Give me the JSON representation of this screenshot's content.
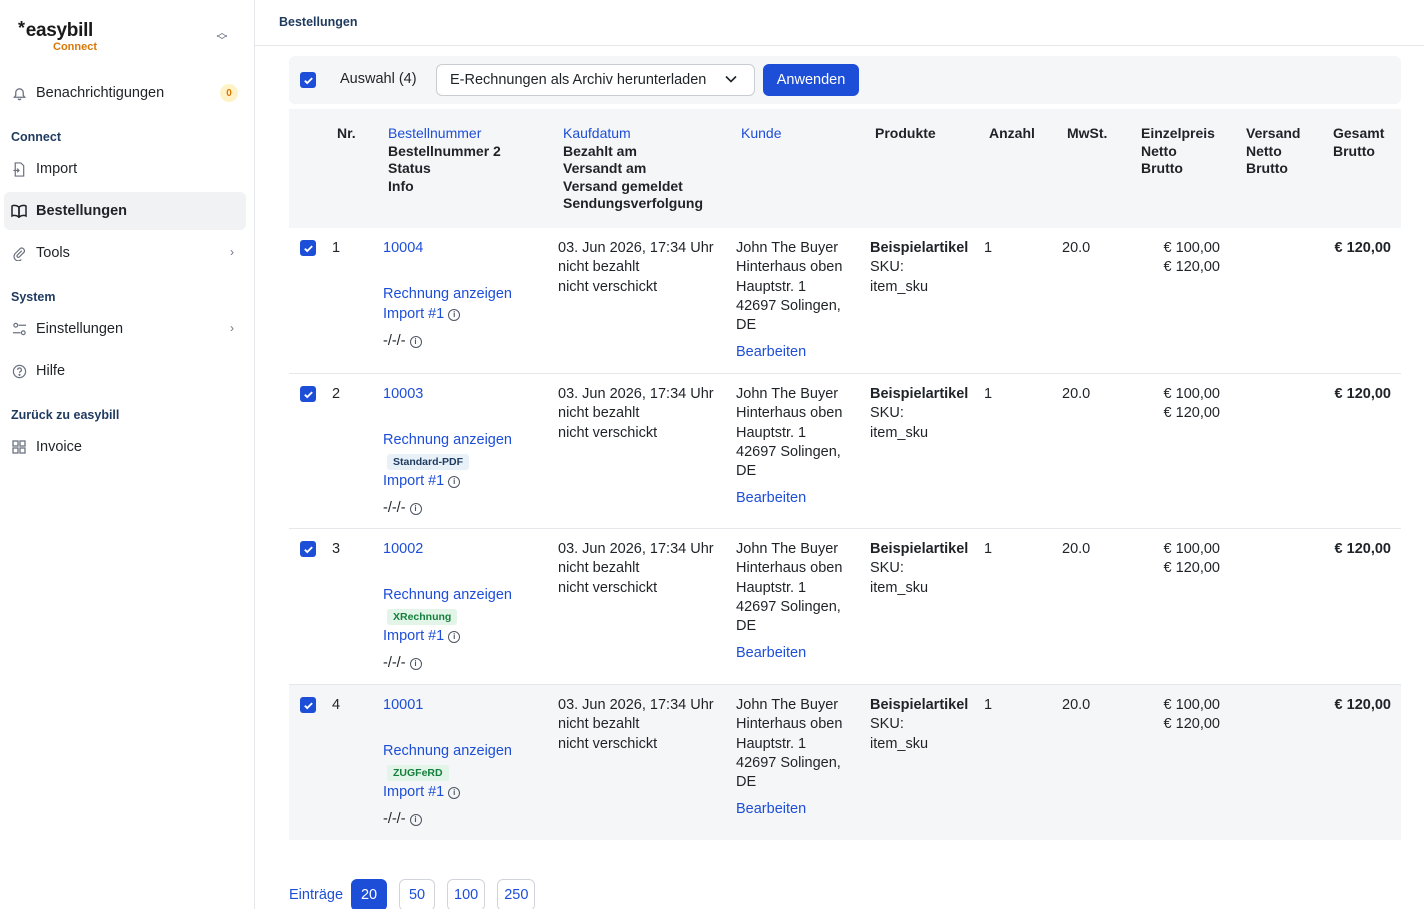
{
  "sidebar": {
    "logo_brand": "easybill",
    "logo_sub": "Connect",
    "notifications": {
      "label": "Benachrichtigungen",
      "count": "0"
    },
    "sections": {
      "connect": "Connect",
      "system": "System",
      "back": "Zurück zu easybill"
    },
    "items": {
      "import": "Import",
      "orders": "Bestellungen",
      "tools": "Tools",
      "settings": "Einstellungen",
      "help": "Hilfe",
      "invoice": "Invoice"
    }
  },
  "header": {
    "breadcrumb": "Bestellungen"
  },
  "bulk": {
    "selection": "Auswahl (4)",
    "action": "E-Rechnungen als Archiv herunterladen",
    "apply": "Anwenden"
  },
  "columns": {
    "nr": "Nr.",
    "order_link": "Bestellnummer",
    "order_lines": [
      "Bestellnummer 2",
      "Status",
      "Info"
    ],
    "date_link": "Kaufdatum",
    "date_lines": [
      "Bezahlt am",
      "Versandt am",
      "Versand gemeldet",
      "Sendungsverfolgung"
    ],
    "customer_link": "Kunde",
    "products": "Produkte",
    "qty": "Anzahl",
    "vat": "MwSt.",
    "unit_price_lines": [
      "Einzelpreis",
      "Netto",
      "Brutto"
    ],
    "shipping_lines": [
      "Versand",
      "Netto",
      "Brutto"
    ],
    "total_lines": [
      "Gesamt",
      "Brutto"
    ]
  },
  "rows": [
    {
      "nr": "1",
      "order": "10004",
      "invoice_link": "Rechnung anzeigen",
      "tag": "",
      "import": "Import #1",
      "info": "-/-/-",
      "date": "03. Jun 2026, 17:34 Uhr",
      "paid": "nicht bezahlt",
      "shipped": "nicht verschickt",
      "customer": [
        "John The Buyer",
        "Hinterhaus oben",
        "Hauptstr. 1",
        "42697 Solingen,",
        "DE"
      ],
      "edit": "Bearbeiten",
      "product": "Beispielartikel",
      "sku_label": "SKU:",
      "sku": "item_sku",
      "qty": "1",
      "vat": "20.0",
      "net": "€ 100,00",
      "gross": "€ 120,00",
      "total": "€ 120,00"
    },
    {
      "nr": "2",
      "order": "10003",
      "invoice_link": "Rechnung anzeigen",
      "tag": "Standard-PDF",
      "import": "Import #1",
      "info": "-/-/-",
      "date": "03. Jun 2026, 17:34 Uhr",
      "paid": "nicht bezahlt",
      "shipped": "nicht verschickt",
      "customer": [
        "John The Buyer",
        "Hinterhaus oben",
        "Hauptstr. 1",
        "42697 Solingen,",
        "DE"
      ],
      "edit": "Bearbeiten",
      "product": "Beispielartikel",
      "sku_label": "SKU:",
      "sku": "item_sku",
      "qty": "1",
      "vat": "20.0",
      "net": "€ 100,00",
      "gross": "€ 120,00",
      "total": "€ 120,00"
    },
    {
      "nr": "3",
      "order": "10002",
      "invoice_link": "Rechnung anzeigen",
      "tag": "XRechnung",
      "import": "Import #1",
      "info": "-/-/-",
      "date": "03. Jun 2026, 17:34 Uhr",
      "paid": "nicht bezahlt",
      "shipped": "nicht verschickt",
      "customer": [
        "John The Buyer",
        "Hinterhaus oben",
        "Hauptstr. 1",
        "42697 Solingen,",
        "DE"
      ],
      "edit": "Bearbeiten",
      "product": "Beispielartikel",
      "sku_label": "SKU:",
      "sku": "item_sku",
      "qty": "1",
      "vat": "20.0",
      "net": "€ 100,00",
      "gross": "€ 120,00",
      "total": "€ 120,00"
    },
    {
      "nr": "4",
      "order": "10001",
      "invoice_link": "Rechnung anzeigen",
      "tag": "ZUGFeRD",
      "import": "Import #1",
      "info": "-/-/-",
      "date": "03. Jun 2026, 17:34 Uhr",
      "paid": "nicht bezahlt",
      "shipped": "nicht verschickt",
      "customer": [
        "John The Buyer",
        "Hinterhaus oben",
        "Hauptstr. 1",
        "42697 Solingen,",
        "DE"
      ],
      "edit": "Bearbeiten",
      "product": "Beispielartikel",
      "sku_label": "SKU:",
      "sku": "item_sku",
      "qty": "1",
      "vat": "20.0",
      "net": "€ 100,00",
      "gross": "€ 120,00",
      "total": "€ 120,00"
    }
  ],
  "pagination": {
    "label": "Einträge",
    "sizes": [
      "20",
      "50",
      "100",
      "250"
    ],
    "active": "20"
  },
  "colors": {
    "primary": "#1d4ed8",
    "accent": "#d97706",
    "heading": "#1e3a5f",
    "tag_green": "#15803d"
  }
}
